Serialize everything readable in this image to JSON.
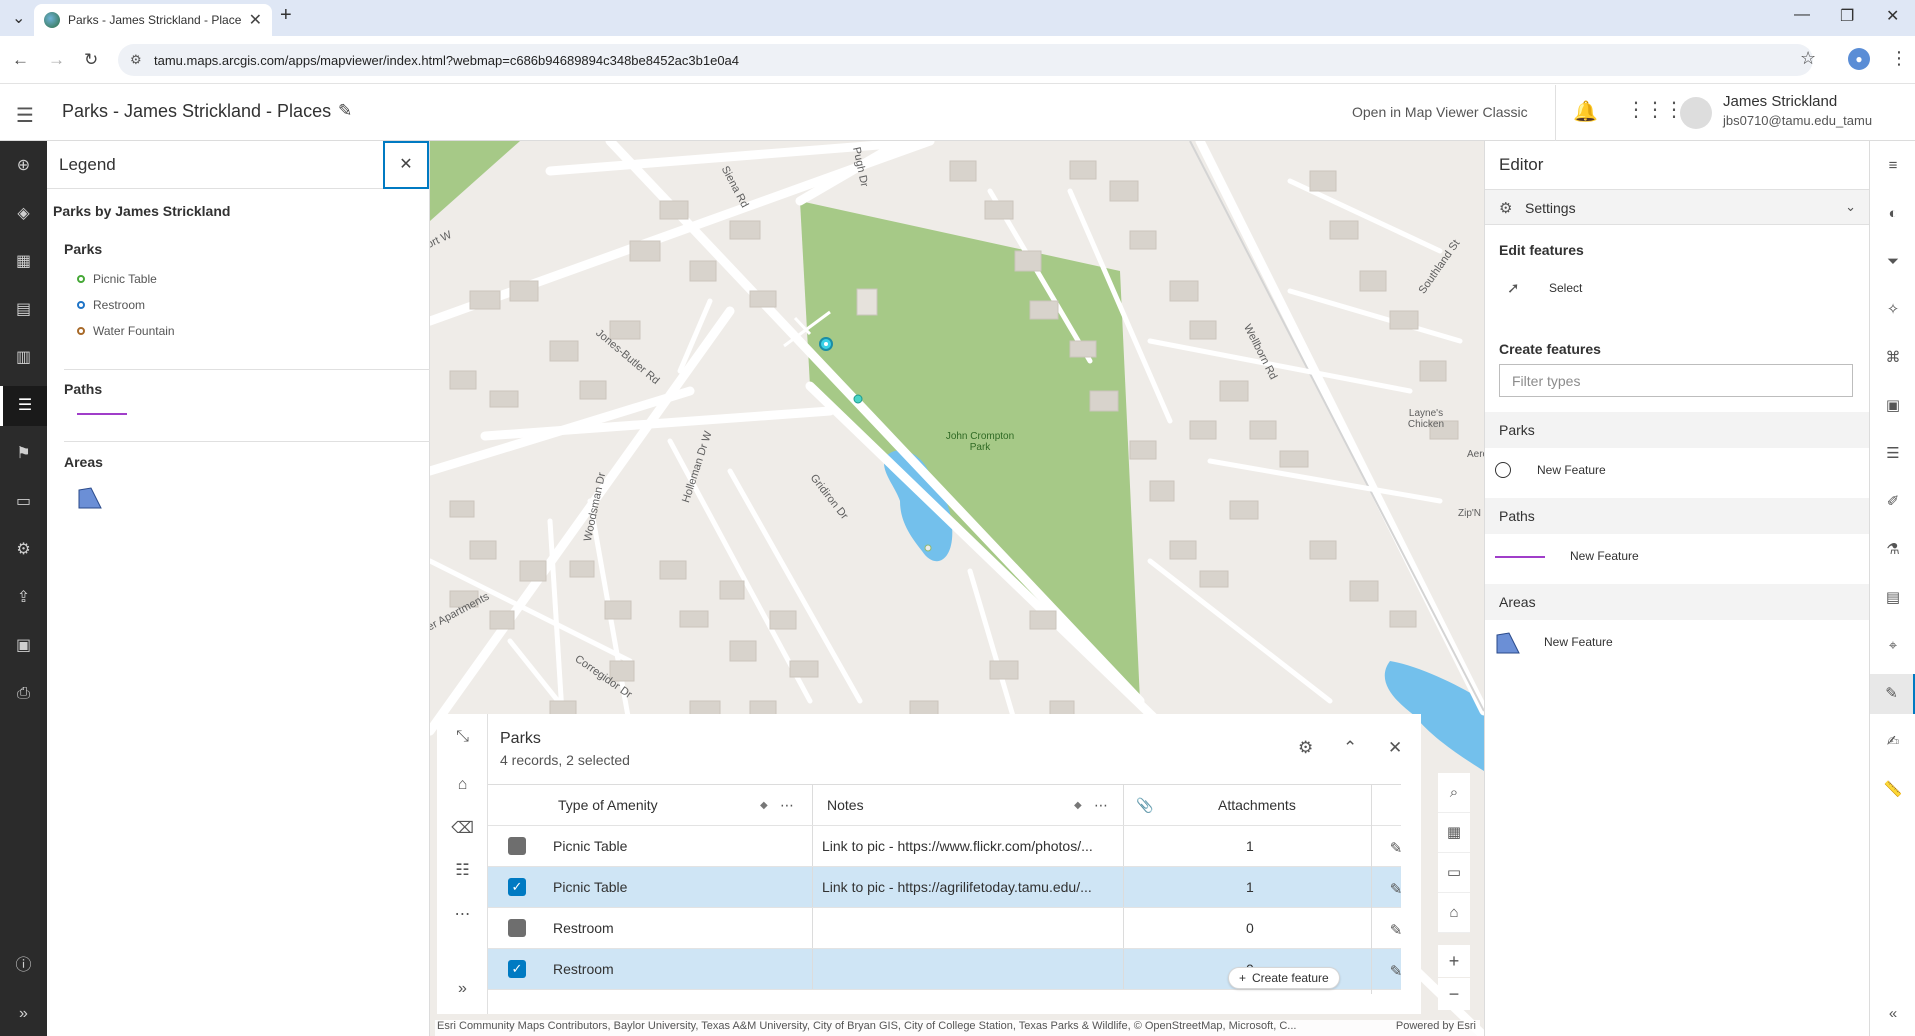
{
  "browser": {
    "tab_title": "Parks - James Strickland - Place",
    "url_site_icon": "site-info",
    "url": "tamu.maps.arcgis.com/apps/mapviewer/index.html?webmap=c686b94689894c348be8452ac3b1e0a4"
  },
  "header": {
    "title": "Parks - James Strickland - Places",
    "classic_link": "Open in Map Viewer Classic",
    "user_name": "James Strickland",
    "user_email": "jbs0710@tamu.edu_tamu"
  },
  "legend": {
    "title": "Legend",
    "layer_title": "Parks by James Strickland",
    "parks_label": "Parks",
    "parks_items": [
      {
        "label": "Picnic Table",
        "color": "#46a837"
      },
      {
        "label": "Restroom",
        "color": "#1f74c7"
      },
      {
        "label": "Water Fountain",
        "color": "#a86a2a"
      }
    ],
    "paths_label": "Paths",
    "paths_color": "#a03ec9",
    "areas_label": "Areas",
    "areas_color": "#6b8fd6"
  },
  "map": {
    "streets": [
      "Jones-Butler Rd",
      "Siena Rd",
      "Pugh Dr",
      "Woodsman Dr",
      "Holleman Dr W",
      "Gridiron Dr",
      "Corregidor Dr",
      "Wellborn Rd",
      "Southland St",
      "ort W",
      "er Apartments"
    ],
    "park_name": "John Crompton Park",
    "poi": [
      "Layne's Chicken",
      "Zip'N",
      "Aero"
    ],
    "attribution": "Esri Community Maps Contributors, Baylor University, Texas A&M University, City of Bryan GIS, City of College Station, Texas Parks & Wildlife, © OpenStreetMap, Microsoft, C...",
    "powered": "Powered by Esri"
  },
  "table": {
    "title": "Parks",
    "subtitle": "4 records, 2 selected",
    "columns": [
      "Type of Amenity",
      "Notes",
      "Attachments"
    ],
    "rows": [
      {
        "type": "Picnic Table",
        "notes": "Link to pic - https://www.flickr.com/photos/...",
        "attachments": "1",
        "selected": false
      },
      {
        "type": "Picnic Table",
        "notes": "Link to pic - https://agrilifetoday.tamu.edu/...",
        "attachments": "1",
        "selected": true
      },
      {
        "type": "Restroom",
        "notes": "",
        "attachments": "0",
        "selected": false
      },
      {
        "type": "Restroom",
        "notes": "",
        "attachments": "0",
        "selected": true
      }
    ],
    "create_feature": "Create feature"
  },
  "editor": {
    "title": "Editor",
    "settings": "Settings",
    "edit_features": "Edit features",
    "select": "Select",
    "create_features": "Create features",
    "filter_placeholder": "Filter types",
    "groups": [
      {
        "label": "Parks",
        "item": "New Feature"
      },
      {
        "label": "Paths",
        "item": "New Feature"
      },
      {
        "label": "Areas",
        "item": "New Feature"
      }
    ]
  },
  "colors": {
    "accent": "#007ac2",
    "park_green": "#a6c987",
    "water": "#73c0ec",
    "selected_row": "#cfe5f5"
  }
}
